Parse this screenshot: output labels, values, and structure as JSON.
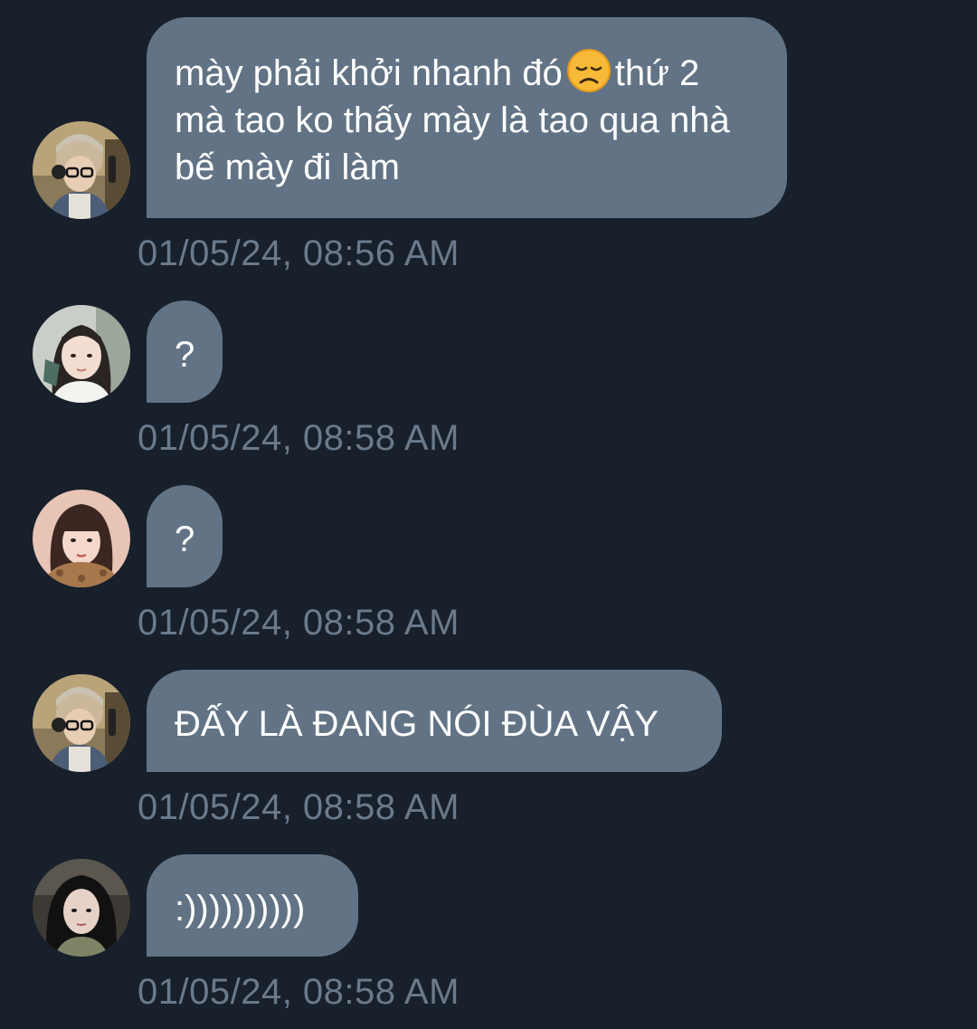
{
  "messages": [
    {
      "avatar": "user-avatar-glasses-headphones",
      "text_before_emoji": "mày phải khởi nhanh đó",
      "emoji": "disappointed-face-emoji",
      "text_after_emoji": "thứ 2 mà tao ko thấy mày là tao qua nhà bế mày đi làm",
      "timestamp": "01/05/24, 08:56 AM"
    },
    {
      "avatar": "user-avatar-dark-hair-white-top",
      "text": "?",
      "timestamp": "01/05/24, 08:58 AM"
    },
    {
      "avatar": "user-avatar-bangs-fur-coat",
      "text": "?",
      "timestamp": "01/05/24, 08:58 AM"
    },
    {
      "avatar": "user-avatar-glasses-headphones",
      "text": "ĐẤY LÀ ĐANG NÓI ĐÙA VẬY",
      "timestamp": "01/05/24, 08:58 AM"
    },
    {
      "avatar": "user-avatar-long-dark-hair",
      "text": ":))))))))))",
      "timestamp": "01/05/24, 08:58 AM"
    }
  ],
  "colors": {
    "background": "#17202b",
    "bubble": "#627385",
    "bubble_text": "#ffffff",
    "timestamp": "#6b7a8b"
  }
}
